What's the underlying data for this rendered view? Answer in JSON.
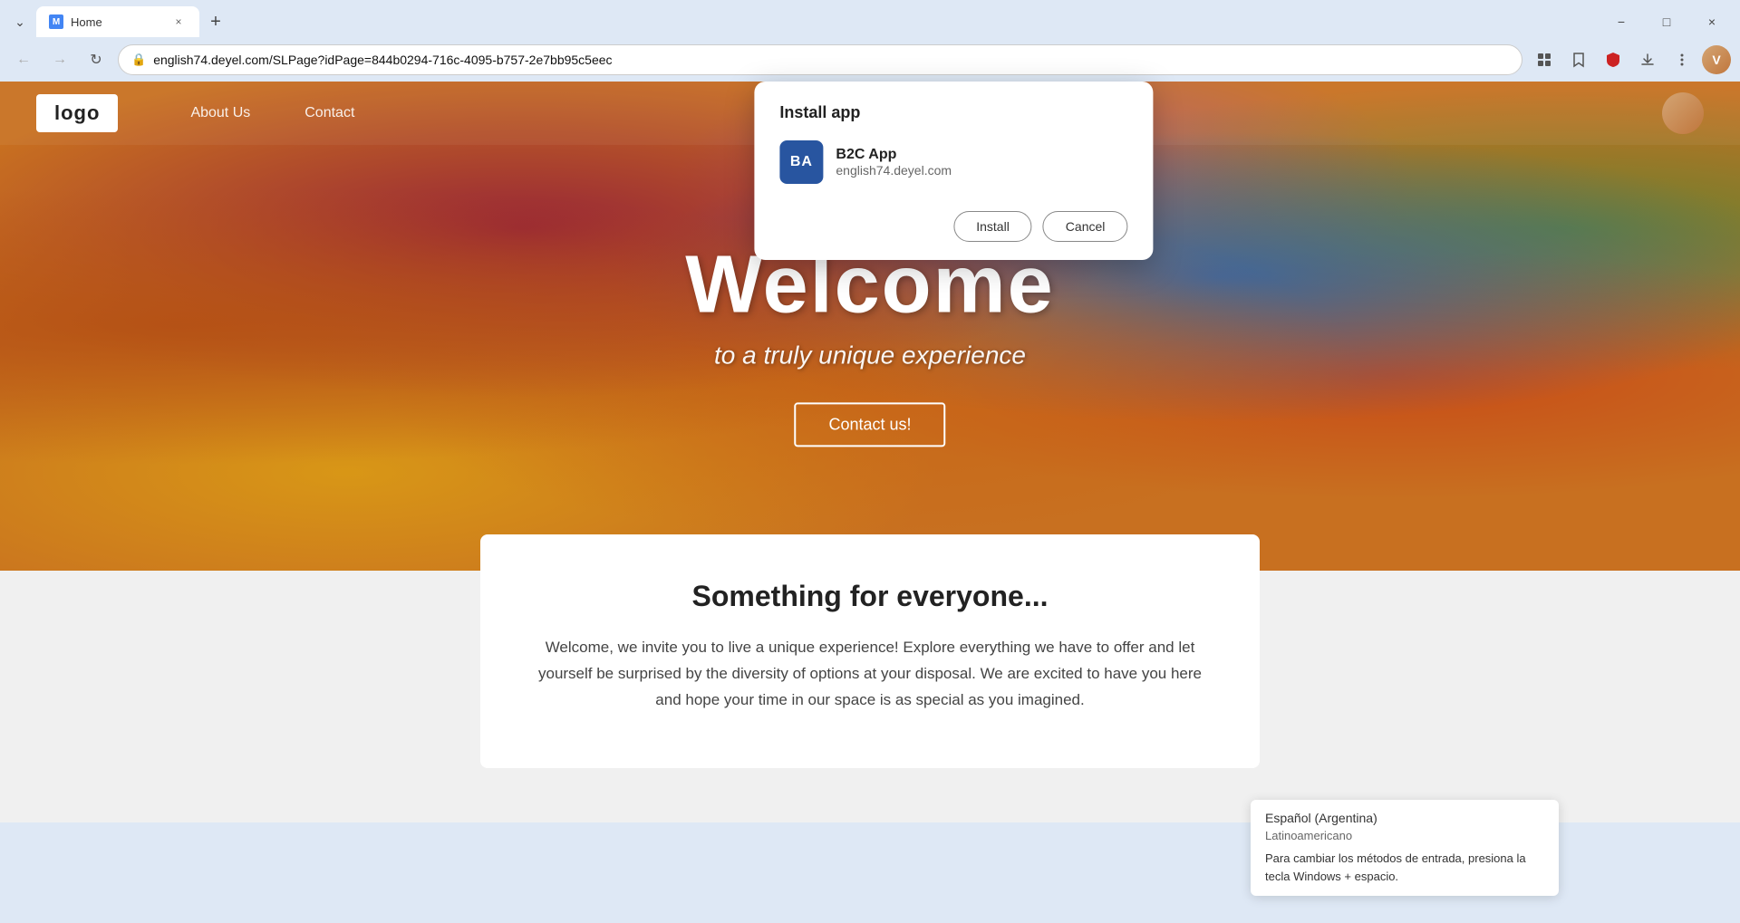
{
  "browser": {
    "tab": {
      "favicon_label": "M",
      "title": "Home",
      "close_label": "×"
    },
    "new_tab_label": "+",
    "url": "english74.deyel.com/SLPage?idPage=844b0294-716c-4095-b757-2e7bb95c5eec",
    "lock_icon": "🔒",
    "back_btn": "←",
    "forward_btn": "→",
    "refresh_btn": "↻",
    "window_controls": {
      "minimize": "−",
      "maximize": "□",
      "close": "×"
    }
  },
  "website": {
    "nav": {
      "logo": "logo",
      "links": [
        "About Us",
        "Contact"
      ]
    },
    "hero": {
      "title": "Welcome",
      "subtitle": "to a truly unique experience",
      "cta_button": "Contact us!"
    },
    "section": {
      "title": "Something for everyone...",
      "body": "Welcome, we invite you to live a unique experience! Explore everything we have to offer and let yourself be surprised by the diversity of options at your disposal. We are excited to have you here and hope your time in our space is as special as you imagined."
    }
  },
  "install_dialog": {
    "title": "Install app",
    "app_icon_label": "BA",
    "app_name": "B2C App",
    "app_domain": "english74.deyel.com",
    "install_btn": "Install",
    "cancel_btn": "Cancel"
  },
  "language_tooltip": {
    "option1": "Español (Argentina)",
    "option2": "Latinoamericano",
    "hint": "Para cambiar los métodos de entrada, presiona la tecla Windows + espacio."
  }
}
